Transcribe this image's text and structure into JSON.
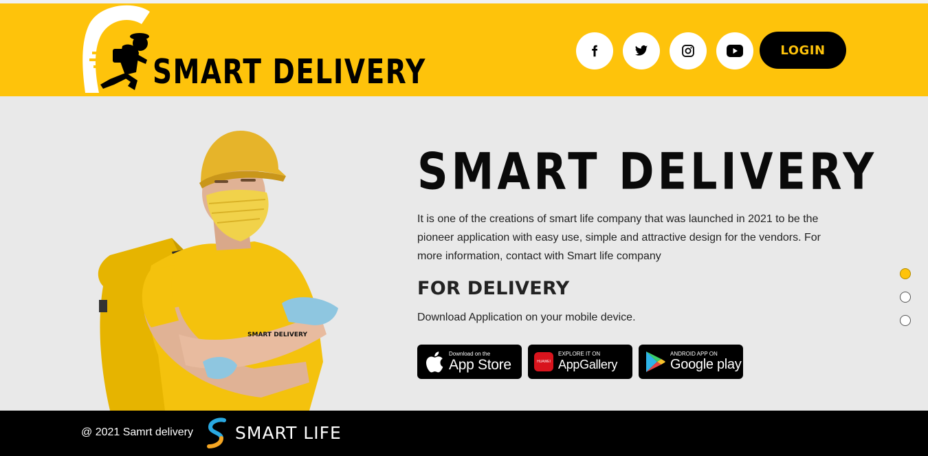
{
  "header": {
    "logo_text": "SMART DELIVERY",
    "socials": [
      {
        "name": "facebook-icon"
      },
      {
        "name": "twitter-icon"
      },
      {
        "name": "instagram-icon"
      },
      {
        "name": "youtube-icon"
      }
    ],
    "login_label": "LOGIN"
  },
  "hero": {
    "title": "SMART DELIVERY",
    "description": "It is one of the creations of smart life company that was launched in 2021 to be the pioneer application with easy use, simple and attractive design for the vendors. For more information, contact with Smart life company",
    "section_title": "FOR DELIVERY",
    "download_text": "Download Application on your mobile device.",
    "shirt_text": "SMART DELIVERY",
    "stores": {
      "app_store": {
        "small": "Download on the",
        "big": "App Store"
      },
      "app_gallery": {
        "small": "EXPLORE IT ON",
        "big": "AppGallery",
        "badge": "HUAWEI"
      },
      "google_play": {
        "small": "ANDROID APP ON",
        "big": "Google play"
      }
    },
    "carousel": {
      "count": 3,
      "active_index": 0
    }
  },
  "footer": {
    "copyright": "@ 2021 Samrt delivery",
    "brand_text": "SMART LIFE"
  },
  "colors": {
    "brand_yellow": "#fec30b",
    "hero_bg": "#e9e9e9",
    "footer_bg": "#000000",
    "text_dark": "#222222"
  }
}
